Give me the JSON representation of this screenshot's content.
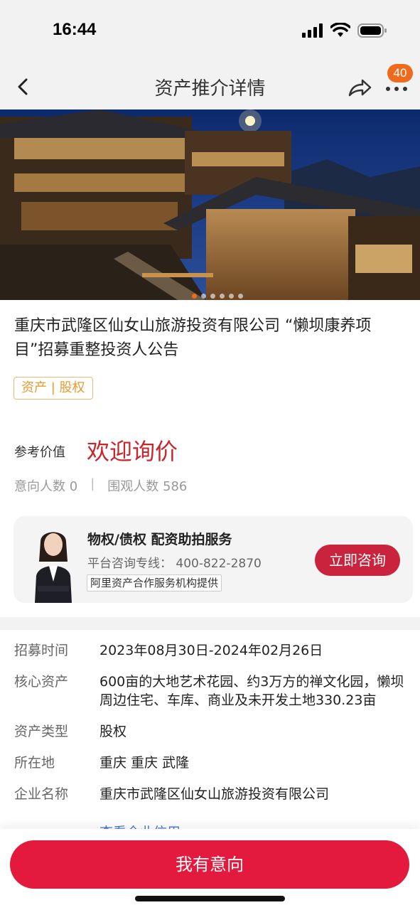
{
  "status_bar": {
    "time": "16:44"
  },
  "nav": {
    "title": "资产推介详情",
    "badge_count": "40"
  },
  "hero": {
    "image_alt": "dusk mountain resort buildings with wooden facades and lights",
    "slides": 6,
    "active_slide": 1
  },
  "project": {
    "title": "重庆市武隆区仙女山旅游投资有限公司 “懒坝康养项目”招募重整投资人公告",
    "tag": "资产 | 股权",
    "ref_label": "参考价值",
    "ref_value": "欢迎询价",
    "intent_count": "意向人数 0",
    "stats_sep": "|",
    "view_count": "围观人数 586"
  },
  "service": {
    "title": "物权/债权 配资助拍服务",
    "phone": "平台咨询专线： 400-822-2870",
    "provider": "阿里资产合作服务机构提供",
    "consult_label": "立即咨询"
  },
  "info": {
    "rows": [
      {
        "label": "招募时间",
        "value": "2023年08月30日-2024年02月26日"
      },
      {
        "label": "核心资产",
        "value": "600亩的大地艺术花园、约3万方的禅文化园，懒坝周边住宅、车库、商业及未开发土地330.23亩"
      },
      {
        "label": "资产类型",
        "value": "股权"
      },
      {
        "label": "所在地",
        "value": "重庆 重庆 武隆"
      },
      {
        "label": "企业名称",
        "value": "重庆市武隆区仙女山旅游投资有限公司"
      }
    ],
    "link": "查看企业信用"
  },
  "bottom": {
    "intent_label": "我有意向"
  },
  "colors": {
    "accent_red": "#e3193e",
    "price_red": "#c9262c",
    "badge_orange": "#f06a1c",
    "tag_orange": "#e89a30"
  }
}
